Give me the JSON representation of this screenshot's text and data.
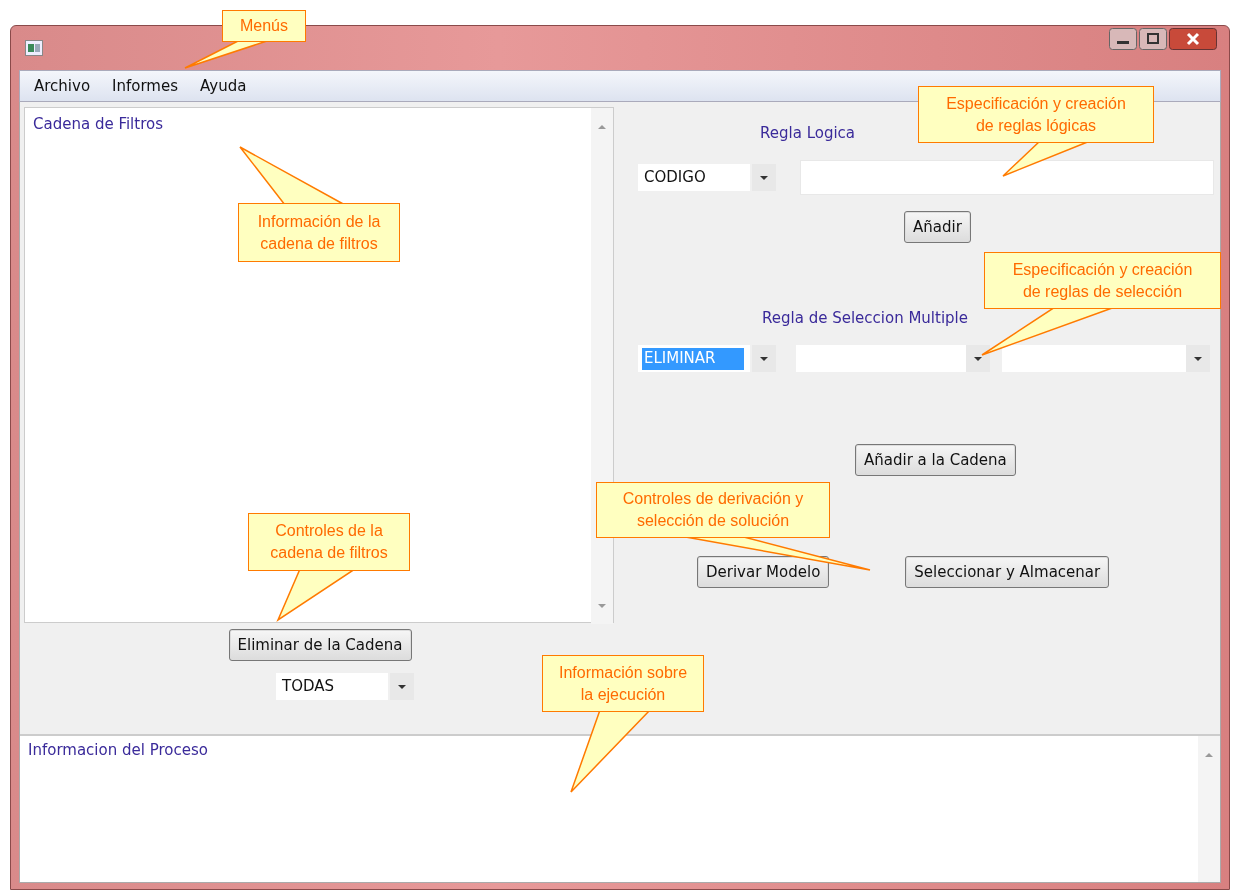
{
  "menu": [
    {
      "label": "Archivo"
    },
    {
      "label": "Informes"
    },
    {
      "label": "Ayuda"
    }
  ],
  "filter_chain": {
    "title": "Cadena de Filtros"
  },
  "logic_rule": {
    "heading": "Regla Logica",
    "combo": {
      "value": "CODIGO"
    },
    "add_button": "Añadir"
  },
  "selection_rule": {
    "heading": "Regla de Seleccion Multiple",
    "combos": [
      {
        "value": "ELIMINAR",
        "text_selected": true
      },
      {
        "text_selected": false
      },
      {
        "text_selected": false
      }
    ]
  },
  "add_to_chain_button": "Añadir a la Cadena",
  "derive_button": "Derivar Modelo",
  "store_button": "Seleccionar y Almacenar",
  "remove_button": "Eliminar de la Cadena",
  "scope_combo": {
    "value": "TODAS"
  },
  "process_info": {
    "title": "Informacion del Proceso"
  },
  "callouts": [
    {
      "text": "Menús"
    },
    {
      "text": "Información de la\ncadena de filtros"
    },
    {
      "text": "Controles de la\ncadena de filtros"
    },
    {
      "text": "Especificación y creación\nde reglas lógicas"
    },
    {
      "text": "Especificación y creación\nde reglas de selección"
    },
    {
      "text": "Controles de derivación y\nselección de solución"
    },
    {
      "text": "Información sobre\nla ejecución"
    }
  ]
}
